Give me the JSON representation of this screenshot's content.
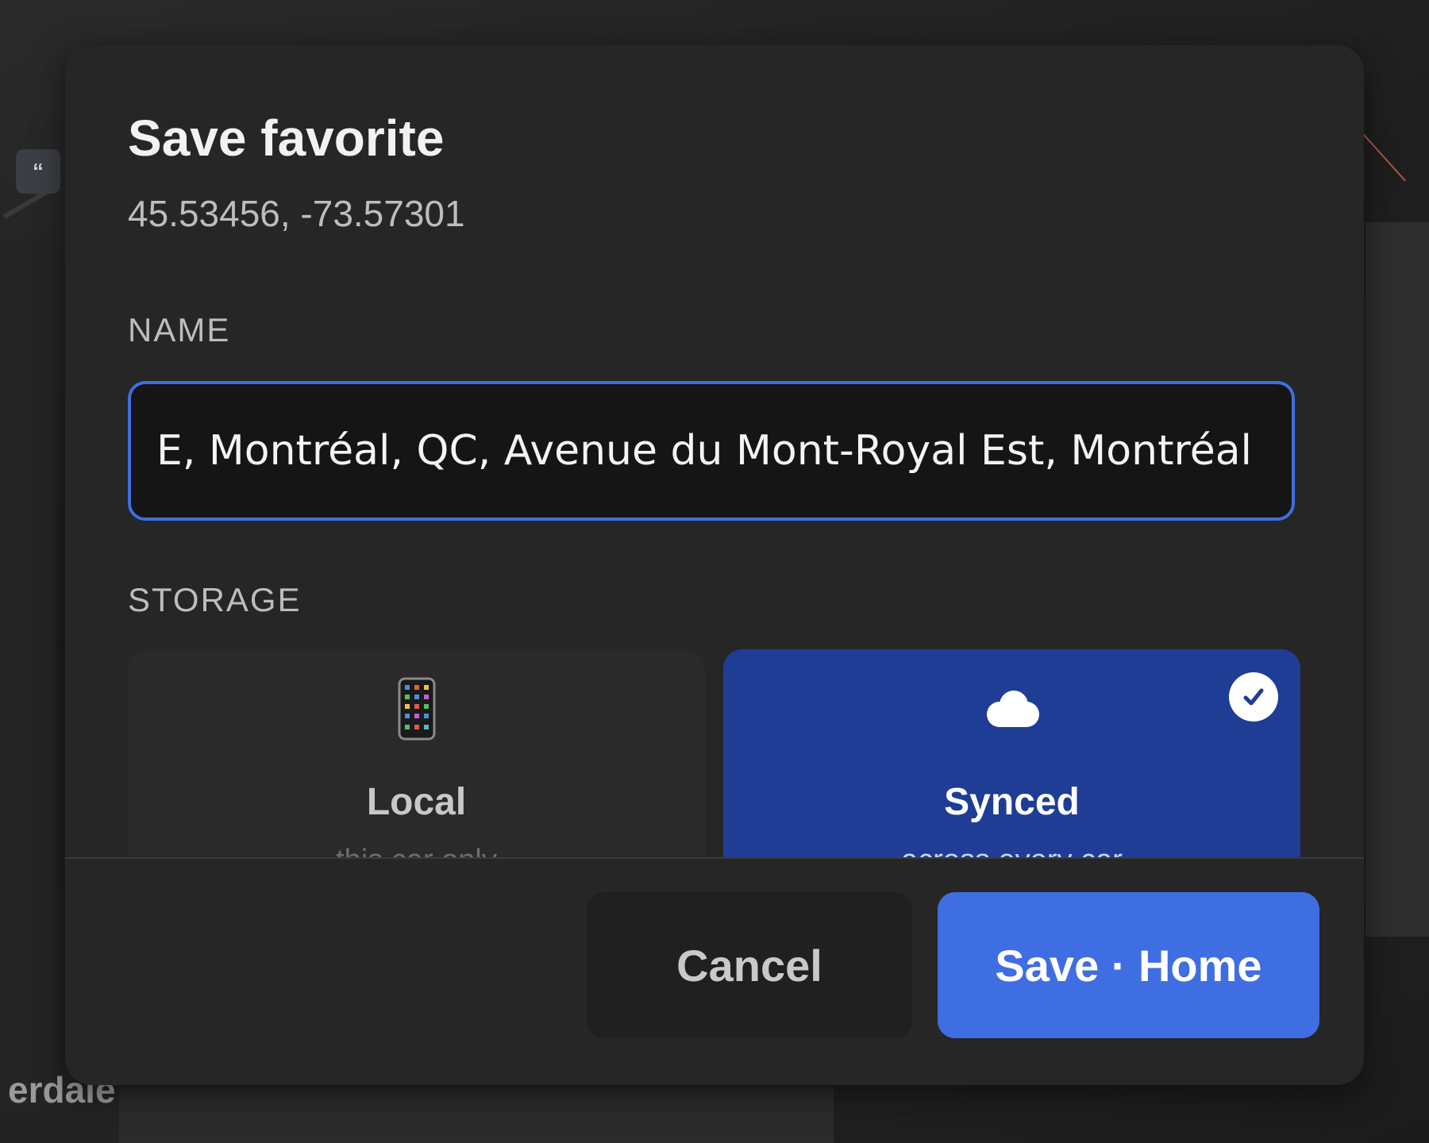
{
  "map": {
    "place_label": "erdale",
    "marker_glyph": "“"
  },
  "dialog": {
    "title": "Save favorite",
    "coordinates": "45.53456, -73.57301",
    "name_section_label": "NAME",
    "name_value": "E, Montréal, QC, Avenue du Mont-Royal Est, Montréal",
    "storage_section_label": "STORAGE",
    "storage_options": [
      {
        "label": "Local",
        "sublabel": "this car only",
        "icon": "phone-icon",
        "selected": false
      },
      {
        "label": "Synced",
        "sublabel": "across every car",
        "icon": "cloud-icon",
        "selected": true
      }
    ],
    "cancel_label": "Cancel",
    "save_label": "Save · Home"
  },
  "colors": {
    "accent": "#3f6ee2",
    "selected_option": "#1f3d95",
    "dialog_bg": "#262626"
  }
}
